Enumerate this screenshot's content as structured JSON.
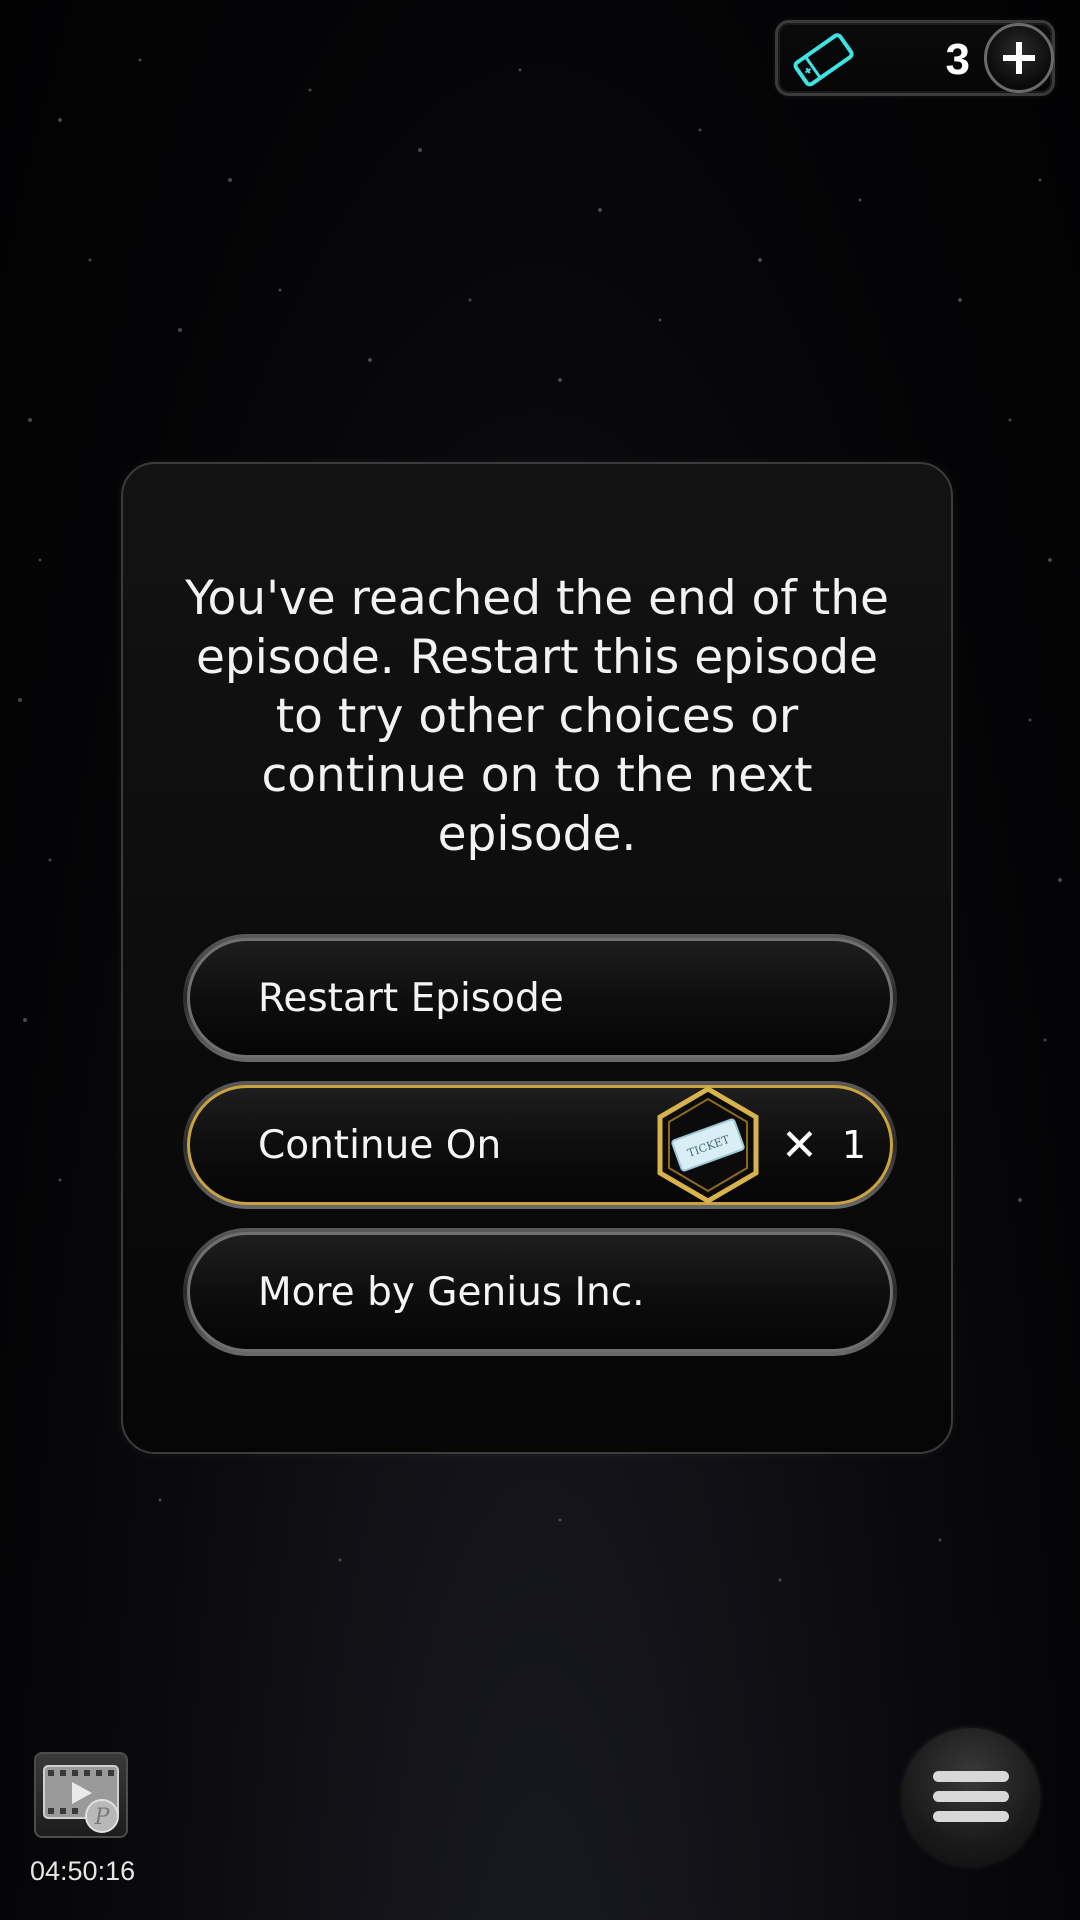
{
  "top_bar": {
    "ticket_count": "3",
    "ticket_icon": "ticket-icon",
    "add_icon": "plus-icon"
  },
  "dialog": {
    "message": "You've reached the end of the episode. Restart this episode to try other choices or continue on to the next episode.",
    "options": [
      {
        "label": "Restart Episode"
      },
      {
        "label": "Continue On",
        "cost_icon": "ticket-badge-icon",
        "times_symbol": "✕",
        "cost": "1"
      },
      {
        "label": "More by Genius Inc."
      }
    ]
  },
  "bottom": {
    "video_icon": "video-reward-icon",
    "timer": "04:50:16",
    "menu_icon": "hamburger-menu-icon"
  },
  "colors": {
    "gold_accent": "#c9a33e",
    "ticket_cyan": "#3fe3e3"
  }
}
